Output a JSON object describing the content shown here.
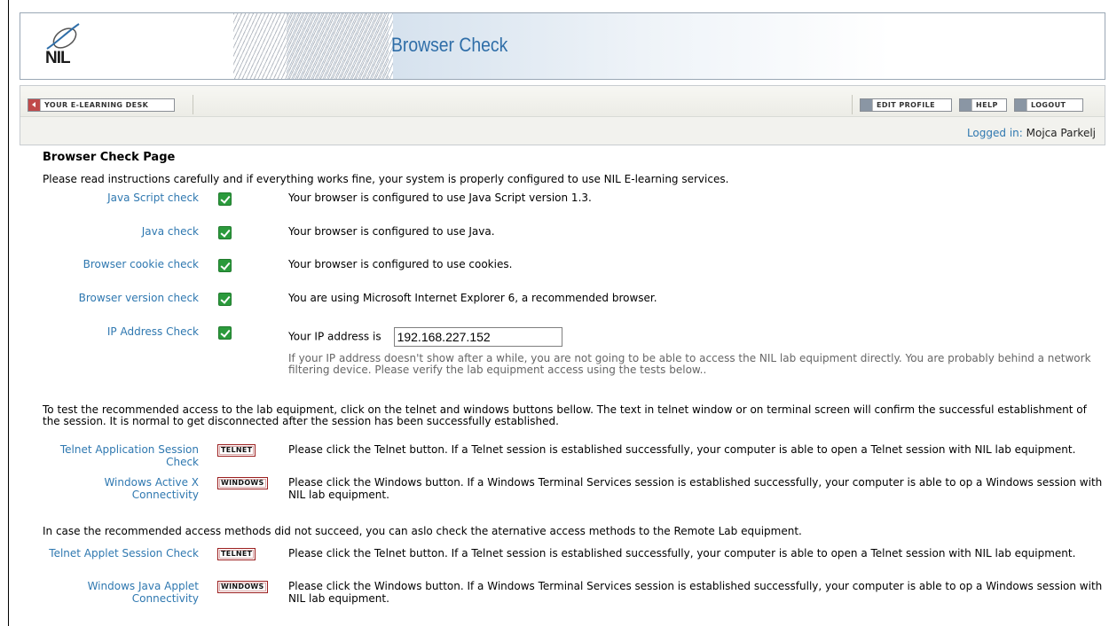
{
  "header": {
    "title": "Browser Check",
    "logo_text": "NIL"
  },
  "toolbar": {
    "desk_label": "YOUR E-LEARNING DESK",
    "edit_profile_label": "EDIT PROFILE",
    "help_label": "HELP",
    "logout_label": "LOGOUT",
    "logged_in_label": "Logged in:",
    "user_name": "Mojca Parkelj"
  },
  "page": {
    "title": "Browser Check Page",
    "intro": "Please read instructions carefully and if everything works fine, your system is properly configured to use NIL E-learning services."
  },
  "checks": [
    {
      "label": "Java Script check",
      "text": "Your browser is configured to use Java Script version 1.3."
    },
    {
      "label": "Java check",
      "text": "Your browser is configured to use Java."
    },
    {
      "label": "Browser cookie check",
      "text": "Your browser is configured to use cookies."
    },
    {
      "label": "Browser version check",
      "text": "You are using Microsoft Internet Explorer 6, a recommended browser."
    },
    {
      "label": "IP Address Check",
      "text": "Your IP address is",
      "ip_value": "192.168.227.152",
      "note": "If your IP address doesn't show after a while, you are not going to be able to access the NIL lab equipment directly. You are probably behind a network filtering device. Please verify the lab equipment access using the tests below.."
    }
  ],
  "recommended": {
    "intro": "To test the recommended access to the lab equipment, click on the telnet and windows buttons bellow. The text in telnet window or on terminal screen will confirm the successful establishment of the session. It is normal to get disconnected after the session has been successfully established.",
    "items": [
      {
        "label": "Telnet Application Session Check",
        "button": "TELNET",
        "text": "Please click the Telnet button. If a Telnet session is established successfully, your computer is able to open a Telnet session with NIL lab equipment."
      },
      {
        "label": "Windows Active X Connectivity",
        "button": "WINDOWS",
        "text": "Please click the Windows button. If a Windows Terminal Services session is established successfully, your computer is able to op a Windows session with NIL lab equipment."
      }
    ]
  },
  "alternative": {
    "intro": "In case the recommended access methods did not succeed, you can aslo check the aternative access methods to the Remote Lab equipment.",
    "items": [
      {
        "label": "Telnet Applet Session Check",
        "button": "TELNET",
        "text": "Please click the Telnet button. If a Telnet session is established successfully, your computer is able to open a Telnet session with NIL lab equipment."
      },
      {
        "label": "Windows Java Applet Connectivity",
        "button": "WINDOWS",
        "text": "Please click the Windows button. If a Windows Terminal Services session is established successfully, your computer is able to op a Windows session with NIL lab equipment."
      }
    ]
  }
}
